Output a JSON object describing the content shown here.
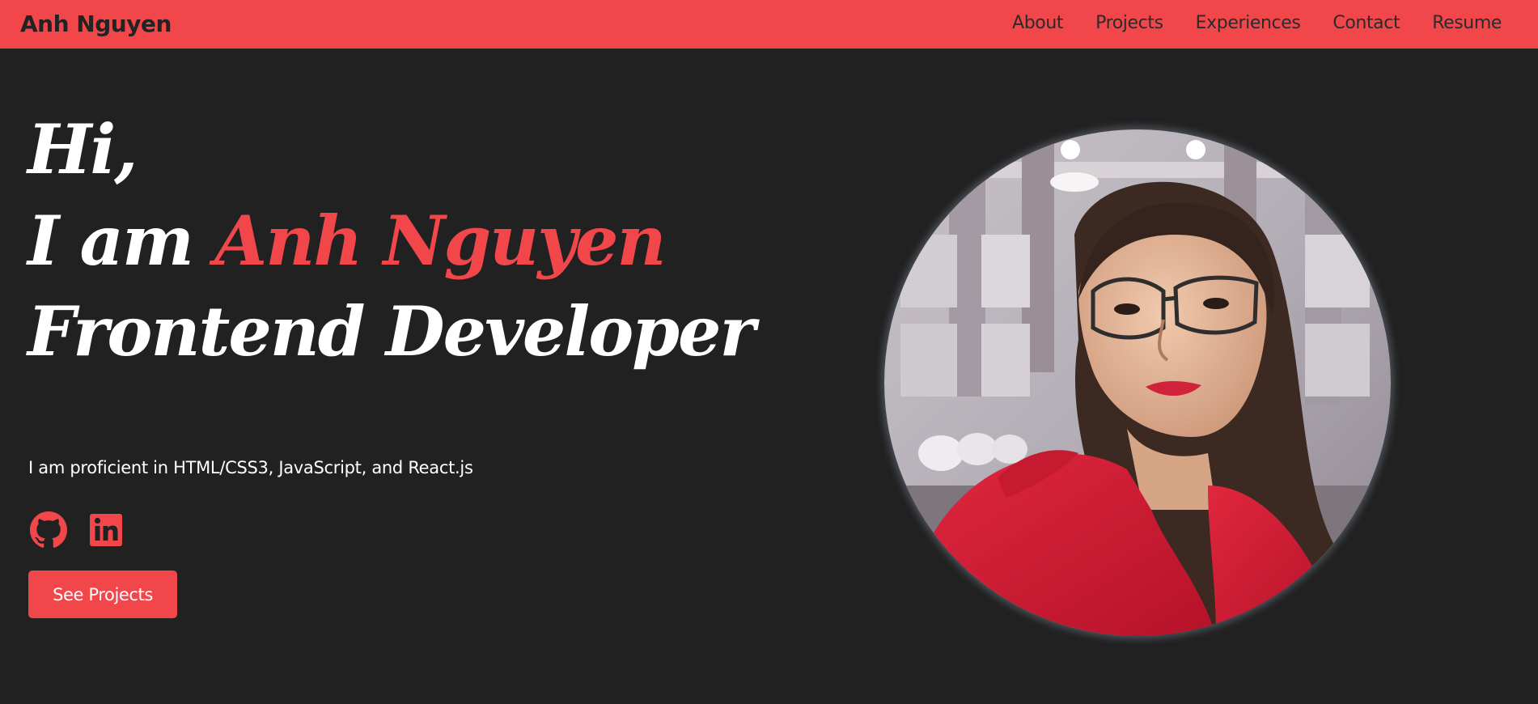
{
  "nav": {
    "brand": "Anh Nguyen",
    "links": [
      "About",
      "Projects",
      "Experiences",
      "Contact",
      "Resume"
    ]
  },
  "hero": {
    "greeting": "Hi,",
    "intro_prefix": "I am ",
    "name": "Anh Nguyen",
    "role": "Frontend Developer",
    "description": "I am proficient in HTML/CSS3, JavaScript, and React.js",
    "social_icons": [
      "github-icon",
      "linkedin-icon"
    ],
    "cta_label": "See Projects"
  },
  "colors": {
    "accent": "#f1474b",
    "background": "#212121",
    "text": "#ffffff"
  }
}
